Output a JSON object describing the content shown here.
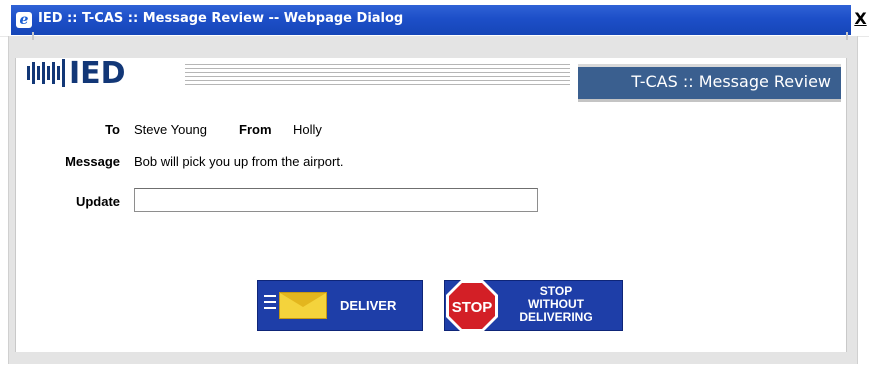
{
  "window": {
    "title": "IED :: T-CAS :: Message Review -- Webpage Dialog",
    "close_label": "X"
  },
  "header": {
    "logo_text": "IED",
    "section_title": "T-CAS :: Message Review"
  },
  "form": {
    "to_label": "To",
    "to_value": "Steve Young",
    "from_label": "From",
    "from_value": "Holly",
    "message_label": "Message",
    "message_value": "Bob will pick you up from the airport.",
    "update_label": "Update",
    "update_value": ""
  },
  "buttons": {
    "deliver_label": "DELIVER",
    "stop_sign_text": "STOP",
    "stop_line1": "STOP",
    "stop_line2": "WITHOUT",
    "stop_line3": "DELIVERING"
  },
  "colors": {
    "title_bar": "#1d4fc8",
    "header_tab": "#3a5f8f",
    "button_blue": "#1e3ea8",
    "stop_red": "#d31f26",
    "envelope_yellow": "#f4d33c"
  },
  "icons": [
    "ie-icon",
    "close-icon",
    "ied-logo",
    "envelope-icon",
    "stop-sign-icon"
  ]
}
